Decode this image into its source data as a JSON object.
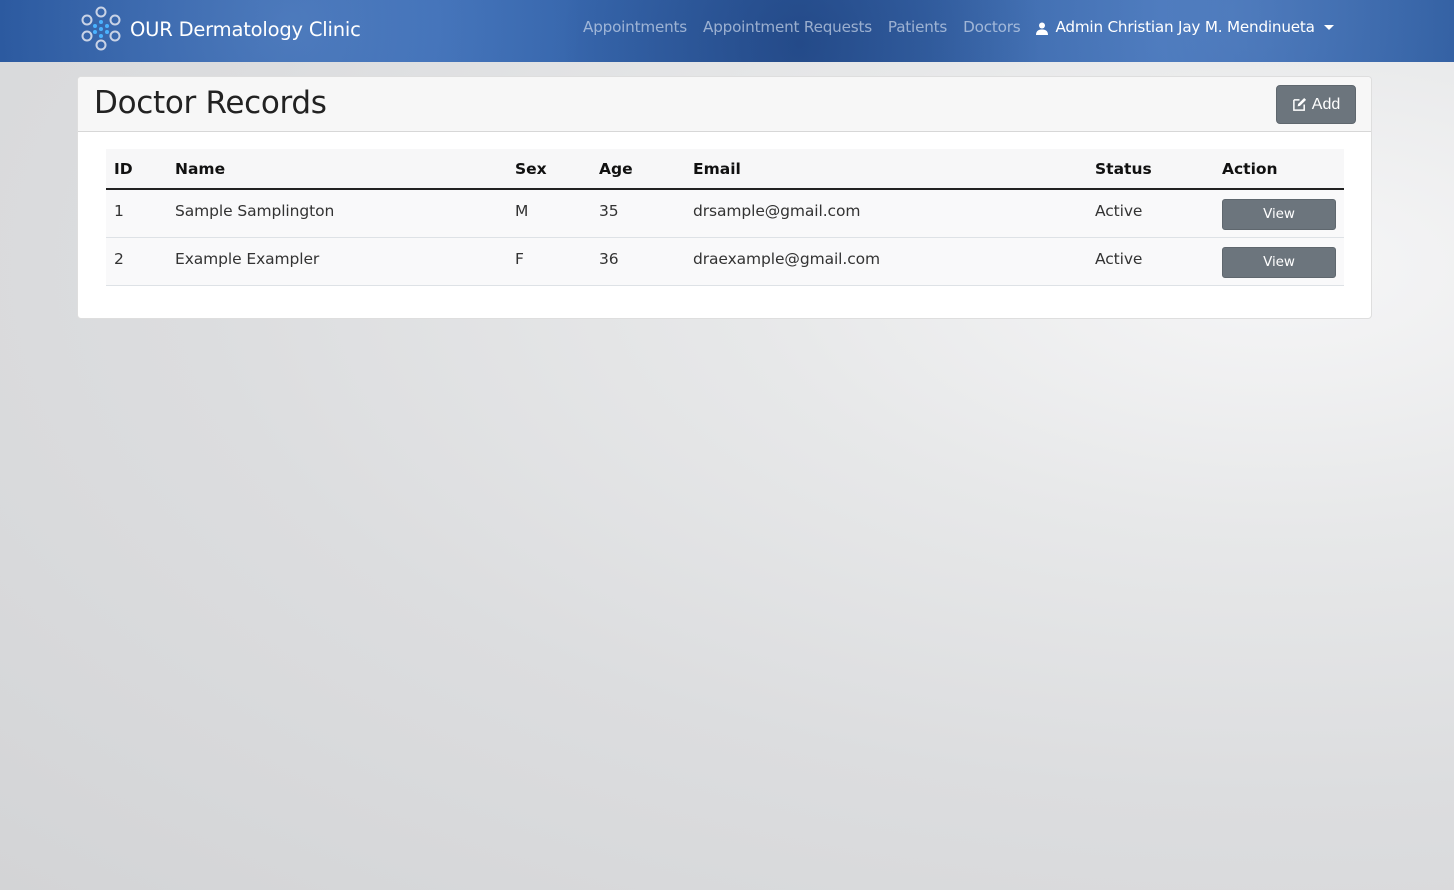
{
  "app": {
    "brand": "OUR Dermatology Clinic",
    "accent_color": "#3b6cb5"
  },
  "nav": {
    "links": [
      "Appointments",
      "Appointment Requests",
      "Patients",
      "Doctors"
    ],
    "user": "Admin Christian Jay M. Mendinueta",
    "user_icon": "user-icon",
    "dropdown_icon": "caret-down-icon"
  },
  "page": {
    "title": "Doctor Records",
    "add_label": "Add",
    "add_icon": "edit-icon"
  },
  "table": {
    "columns": [
      "ID",
      "Name",
      "Sex",
      "Age",
      "Email",
      "Status",
      "Action"
    ],
    "rows": [
      {
        "id": "1",
        "name": "Sample Samplington",
        "sex": "M",
        "age": "35",
        "email": "drsample@gmail.com",
        "status": "Active",
        "action": "View"
      },
      {
        "id": "2",
        "name": "Example Exampler",
        "sex": "F",
        "age": "36",
        "email": "draexample@gmail.com",
        "status": "Active",
        "action": "View"
      }
    ]
  }
}
